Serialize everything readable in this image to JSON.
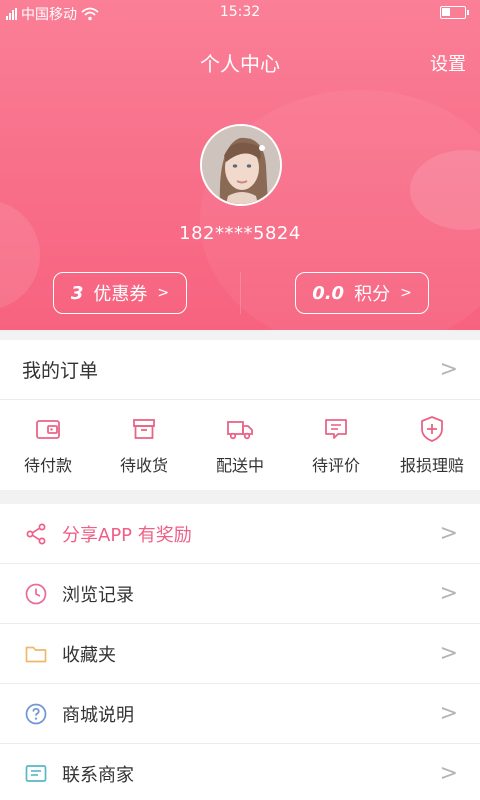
{
  "statusbar": {
    "carrier": "中国移动",
    "time": "15:32"
  },
  "header": {
    "title": "个人中心",
    "settings_label": "设置"
  },
  "profile": {
    "phone": "182****5824"
  },
  "coupon": {
    "count": "3",
    "label": "优惠券",
    "arrow": ">"
  },
  "points": {
    "count": "0.0",
    "label": "积分",
    "arrow": ">"
  },
  "orders": {
    "title": "我的订单",
    "chevron": ">",
    "items": [
      {
        "label": "待付款",
        "icon": "wallet-icon"
      },
      {
        "label": "待收货",
        "icon": "box-icon"
      },
      {
        "label": "配送中",
        "icon": "truck-icon"
      },
      {
        "label": "待评价",
        "icon": "comment-icon"
      },
      {
        "label": "报损理赔",
        "icon": "shield-plus-icon"
      }
    ]
  },
  "menu": [
    {
      "label": "分享APP 有奖励",
      "icon": "share-icon",
      "color": "#ef5f86"
    },
    {
      "label": "浏览记录",
      "icon": "clock-icon",
      "color": "#e86b99"
    },
    {
      "label": "收藏夹",
      "icon": "folder-icon",
      "color": "#f1b76b"
    },
    {
      "label": "商城说明",
      "icon": "question-icon",
      "color": "#6d95d6"
    },
    {
      "label": "联系商家",
      "icon": "message-icon",
      "color": "#56b8c4"
    }
  ],
  "colors": {
    "accent": "#f86d88",
    "icon_pink": "#e96587"
  }
}
